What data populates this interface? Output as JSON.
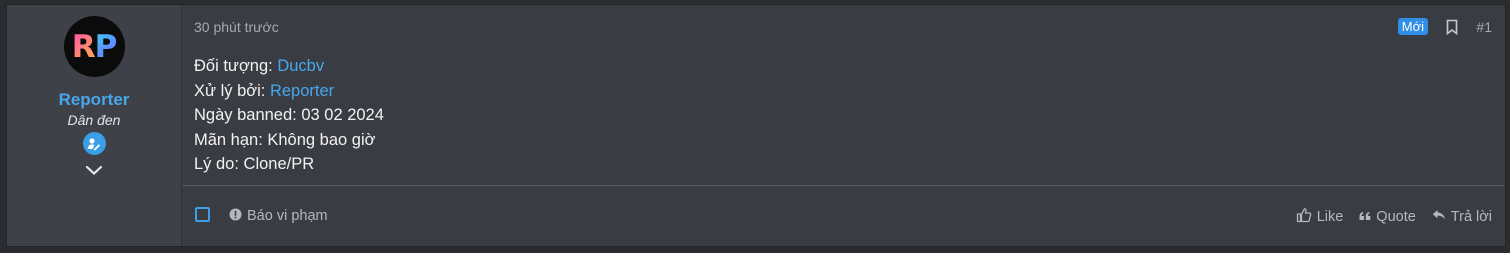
{
  "user": {
    "avatar_text": "RP",
    "name": "Reporter",
    "title": "Dân đen"
  },
  "post": {
    "time": "30 phút trước",
    "new_badge": "Mới",
    "number": "#1",
    "lines": [
      {
        "label": "Đối tượng: ",
        "value": "Ducbv"
      },
      {
        "label": "Xử lý bởi: ",
        "value": "Reporter"
      },
      {
        "text": "Ngày banned: 03 02 2024"
      },
      {
        "text": "Mãn hạn: Không bao giờ"
      },
      {
        "text": "Lý do: Clone/PR"
      }
    ]
  },
  "footer": {
    "report_label": "Báo vi phạm",
    "like_label": "Like",
    "quote_label": "Quote",
    "reply_label": "Trả lời"
  },
  "icons": [
    "bookmark-icon",
    "report-icon",
    "like-icon",
    "quote-icon",
    "reply-icon",
    "chevron-down-icon",
    "user-badge-icon"
  ]
}
